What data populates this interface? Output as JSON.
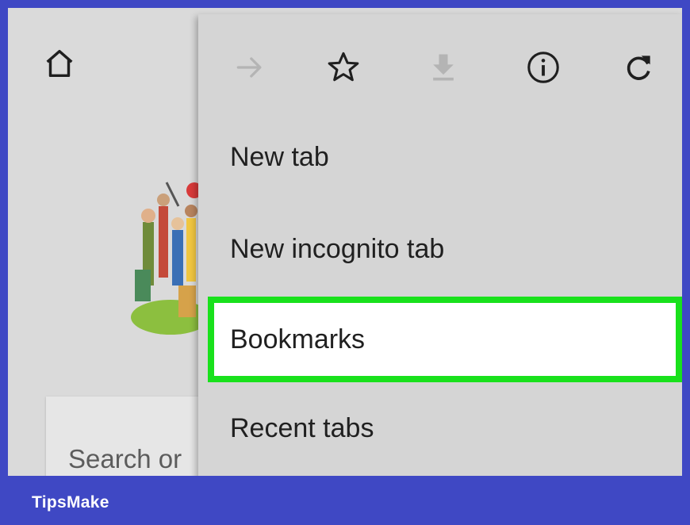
{
  "toolbar": {
    "icons": [
      "home-icon",
      "forward-arrow-icon",
      "star-icon",
      "download-icon",
      "info-icon",
      "refresh-icon"
    ]
  },
  "search": {
    "placeholder": "Search or"
  },
  "menu": {
    "items": [
      {
        "label": "New tab"
      },
      {
        "label": "New incognito tab"
      },
      {
        "label": "Bookmarks",
        "highlighted": true
      },
      {
        "label": "Recent tabs"
      }
    ]
  },
  "footer": {
    "brand": "TipsMake"
  },
  "colors": {
    "frame": "#3f48c4",
    "highlight_border": "#19e11c",
    "menu_bg": "#d5d5d5",
    "screen_bg": "#dadada"
  }
}
